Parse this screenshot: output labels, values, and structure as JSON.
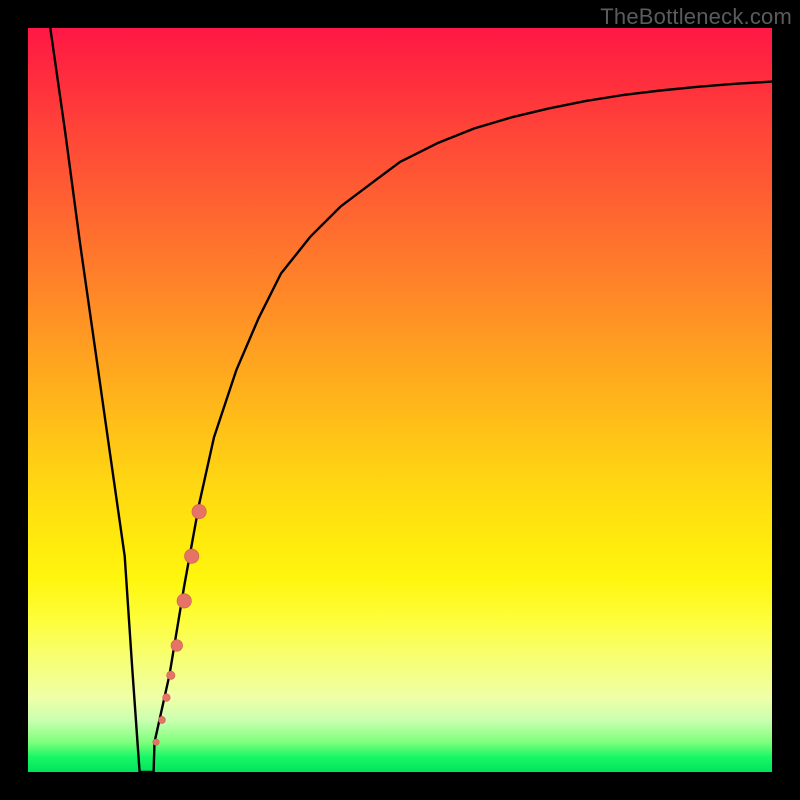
{
  "watermark": "TheBottleneck.com",
  "colors": {
    "background": "#000000",
    "curve": "#000000",
    "marker_fill": "#e57366",
    "marker_stroke": "#cf5b50"
  },
  "chart_data": {
    "type": "line",
    "title": "",
    "xlabel": "",
    "ylabel": "",
    "xlim": [
      0,
      100
    ],
    "ylim": [
      0,
      100
    ],
    "grid": false,
    "axes_visible": false,
    "series": [
      {
        "name": "bottleneck-curve",
        "x": [
          3,
          5,
          7,
          9,
          11,
          13,
          14,
          15,
          17,
          19,
          21,
          23,
          25,
          28,
          31,
          34,
          38,
          42,
          46,
          50,
          55,
          60,
          65,
          70,
          75,
          80,
          85,
          90,
          95,
          100
        ],
        "values": [
          100,
          86,
          71,
          57,
          43,
          29,
          14,
          0,
          4,
          13,
          25,
          36,
          45,
          54,
          61,
          67,
          72,
          76,
          79,
          82,
          84.5,
          86.5,
          88,
          89.2,
          90.2,
          91,
          91.6,
          92.1,
          92.5,
          92.8
        ]
      }
    ],
    "scatter": [
      {
        "name": "highlight-points",
        "points": [
          {
            "x": 17.2,
            "y": 4.0,
            "r": 3.2
          },
          {
            "x": 18.0,
            "y": 7.0,
            "r": 3.5
          },
          {
            "x": 18.6,
            "y": 10.0,
            "r": 3.8
          },
          {
            "x": 19.2,
            "y": 13.0,
            "r": 4.2
          },
          {
            "x": 20.0,
            "y": 17.0,
            "r": 5.8
          },
          {
            "x": 21.0,
            "y": 23.0,
            "r": 7.2
          },
          {
            "x": 22.0,
            "y": 29.0,
            "r": 7.2
          },
          {
            "x": 23.0,
            "y": 35.0,
            "r": 7.2
          }
        ]
      }
    ]
  }
}
